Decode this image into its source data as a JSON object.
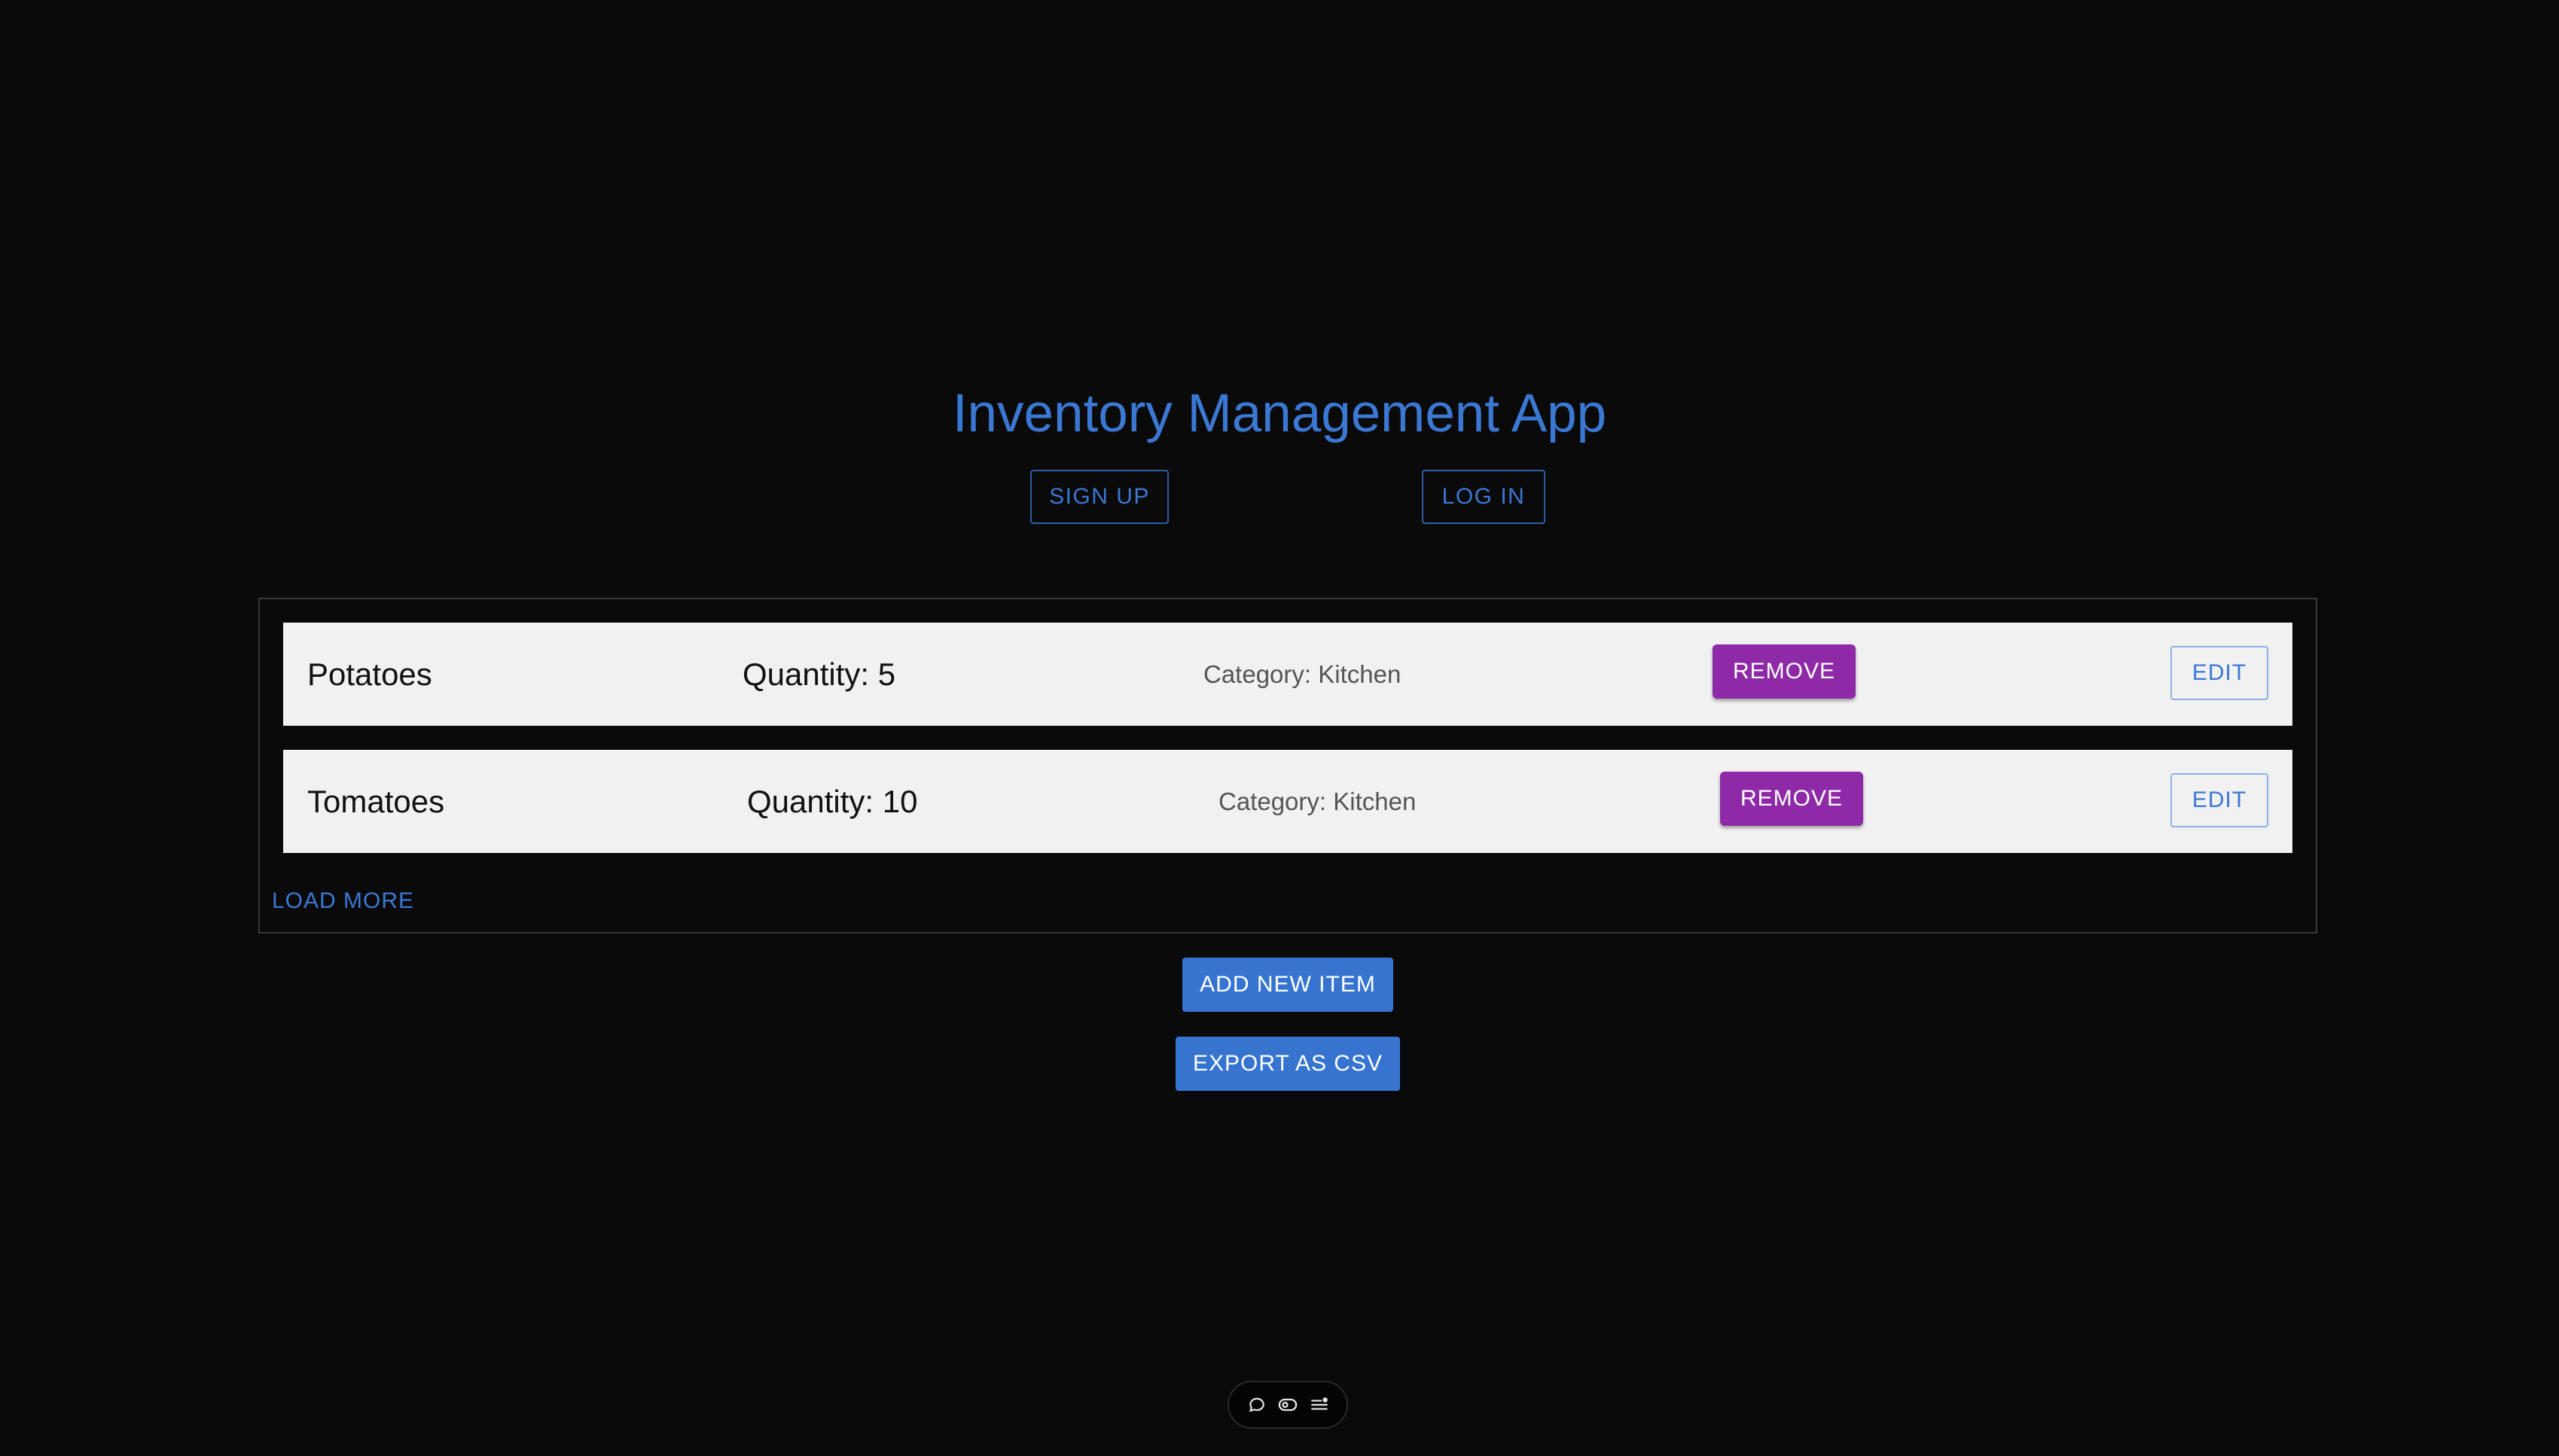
{
  "header": {
    "title": "Inventory Management App",
    "sign_up_label": "SIGN UP",
    "log_in_label": "LOG IN"
  },
  "items": [
    {
      "name": "Potatoes",
      "quantity": "Quantity: 5",
      "category": "Category: Kitchen",
      "remove_label": "REMOVE",
      "edit_label": "EDIT"
    },
    {
      "name": "Tomatoes",
      "quantity": "Quantity: 10",
      "category": "Category: Kitchen",
      "remove_label": "REMOVE",
      "edit_label": "EDIT"
    }
  ],
  "list": {
    "load_more_label": "LOAD MORE"
  },
  "actions": {
    "add_new_item_label": "ADD NEW ITEM",
    "export_csv_label": "EXPORT AS CSV"
  },
  "toolbar": {
    "icons": [
      "comment-icon",
      "eye-toggle-icon",
      "settings-list-icon"
    ]
  },
  "colors": {
    "background": "#0a0a0a",
    "accent_blue": "#3674d0",
    "remove_purple": "#8e2aa8",
    "row_background": "#f1f1f1"
  }
}
